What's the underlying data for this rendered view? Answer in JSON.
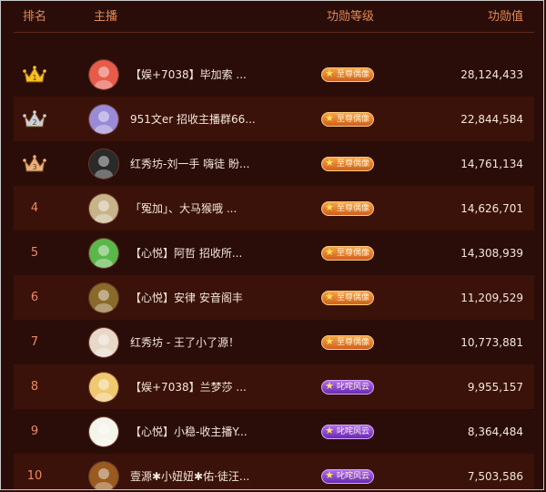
{
  "header": {
    "rank": "排名",
    "anchor": "主播",
    "level": "功勋等级",
    "value": "功勋值"
  },
  "rows": [
    {
      "rank": "1",
      "name": "【娱+7038】毕加索 ...",
      "level": "至尊偶像",
      "level_color": "orange",
      "value": "28,124,433",
      "crown": "gold",
      "avatar_color": "#e85a4a"
    },
    {
      "rank": "2",
      "name": "951文er 招收主播群66...",
      "level": "至尊偶像",
      "level_color": "orange",
      "value": "22,844,584",
      "crown": "silver",
      "avatar_color": "#9a8ad8"
    },
    {
      "rank": "3",
      "name": "红秀坊-刘一手 嗨徒 盼...",
      "level": "至尊偶像",
      "level_color": "orange",
      "value": "14,761,134",
      "crown": "bronze",
      "avatar_color": "#2a2a2a"
    },
    {
      "rank": "4",
      "name": "「冤加」、大马猴哦 ...",
      "level": "至尊偶像",
      "level_color": "orange",
      "value": "14,626,701",
      "crown": "",
      "avatar_color": "#c8b48a"
    },
    {
      "rank": "5",
      "name": "【心悦】阿哲 招收所...",
      "level": "至尊偶像",
      "level_color": "orange",
      "value": "14,308,939",
      "crown": "",
      "avatar_color": "#5ab84a"
    },
    {
      "rank": "6",
      "name": "【心悦】安律 安音阁丰",
      "level": "至尊偶像",
      "level_color": "orange",
      "value": "11,209,529",
      "crown": "",
      "avatar_color": "#8a6a2a"
    },
    {
      "rank": "7",
      "name": "红秀坊 - 王了小了源！",
      "level": "至尊偶像",
      "level_color": "orange",
      "value": "10,773,881",
      "crown": "",
      "avatar_color": "#e8d8c8"
    },
    {
      "rank": "8",
      "name": "【娱+7038】兰梦莎 ...",
      "level": "叱咤风云",
      "level_color": "purple",
      "value": "9,955,157",
      "crown": "",
      "avatar_color": "#f0c870"
    },
    {
      "rank": "9",
      "name": "【心悦】小稳-收主播Y...",
      "level": "叱咤风云",
      "level_color": "purple",
      "value": "8,364,484",
      "crown": "",
      "avatar_color": "#f4f4ea"
    },
    {
      "rank": "10",
      "name": "壹源✱小妞妞✱佑·徒汪...",
      "level": "叱咤风云",
      "level_color": "purple",
      "value": "7,503,586",
      "crown": "",
      "avatar_color": "#9a5a20"
    }
  ],
  "colors": {
    "gold": "#f8c020",
    "silver": "#c8d0e0",
    "bronze": "#e8b080"
  }
}
